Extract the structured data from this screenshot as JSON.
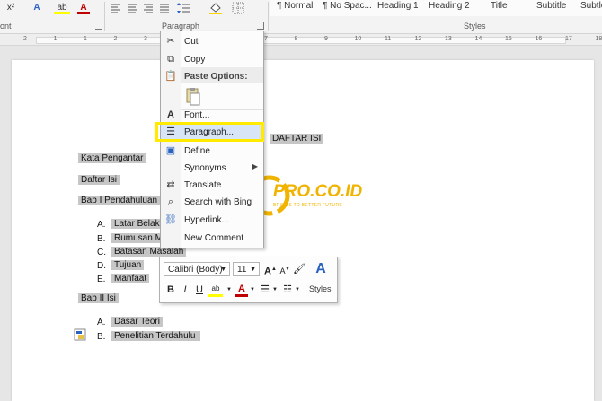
{
  "ribbon": {
    "superscript": "x²",
    "font_color_btn": "A",
    "highlight_btn": "ab",
    "font_group_label": "ont",
    "paragraph_group_label": "Paragraph",
    "styles_group_label": "Styles",
    "styles": [
      "¶ Normal",
      "¶ No Spac...",
      "Heading 1",
      "Heading 2",
      "Title",
      "Subtitle",
      "Subtle"
    ]
  },
  "ruler": {
    "numbers": [
      "2",
      "1",
      "1",
      "2",
      "3",
      "4",
      "5",
      "6",
      "7",
      "8",
      "9",
      "10",
      "11",
      "12",
      "13",
      "14",
      "15",
      "16",
      "17",
      "18"
    ]
  },
  "document": {
    "title": "DAFTAR ISI",
    "lines": [
      {
        "text": "Kata Pengantar"
      },
      {
        "text": "Daftar Isi"
      },
      {
        "text": "Bab I Pendahuluan"
      },
      {
        "marker": "A.",
        "text": "Latar Belak"
      },
      {
        "marker": "B.",
        "text": "Rumusan M"
      },
      {
        "marker": "C.",
        "text": "Batasan Masalah"
      },
      {
        "marker": "D.",
        "text": "Tujuan"
      },
      {
        "marker": "E.",
        "text": "Manfaat"
      },
      {
        "text": "Bab II Isi"
      },
      {
        "marker": "A.",
        "text": "Dasar Teori"
      },
      {
        "marker": "B.",
        "text": "Penelitian Terdahulu"
      }
    ]
  },
  "context_menu": {
    "cut": "Cut",
    "copy": "Copy",
    "paste_options": "Paste Options:",
    "font": "Font...",
    "paragraph": "Paragraph...",
    "define": "Define",
    "synonyms": "Synonyms",
    "translate": "Translate",
    "search": "Search with Bing",
    "hyperlink": "Hyperlink...",
    "new_comment": "New Comment"
  },
  "mini_toolbar": {
    "font_name": "Calibri (Body)",
    "font_size": "11",
    "bold": "B",
    "italic": "I",
    "underline": "U",
    "styles_label": "Styles"
  },
  "watermark": {
    "brand": "PRO.CO.ID",
    "tagline": "BRINGS TO BETTER FUTURE"
  },
  "colors": {
    "highlight_box": "#ffea00",
    "selection": "#c6c6c6",
    "menu_hover": "#d7e5f7",
    "logo": "#f0b400"
  }
}
